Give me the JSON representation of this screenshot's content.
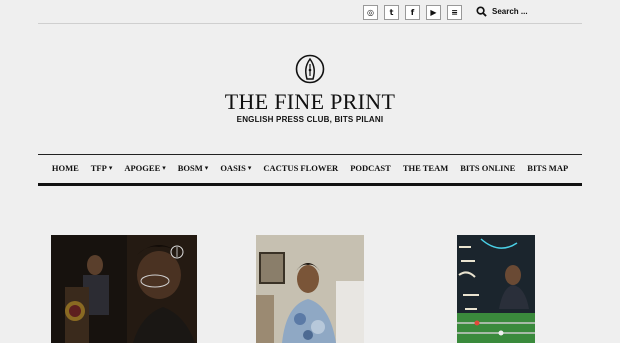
{
  "header": {
    "social": [
      {
        "icon": "instagram-icon",
        "glyph": "◎"
      },
      {
        "icon": "twitter-icon",
        "glyph": "t"
      },
      {
        "icon": "facebook-icon",
        "glyph": "f"
      },
      {
        "icon": "youtube-icon",
        "glyph": "▶"
      },
      {
        "icon": "spotify-icon",
        "glyph": "≡"
      }
    ],
    "search_placeholder": "Search ..."
  },
  "brand": {
    "title": "THE FINE PRINT",
    "subtitle": "ENGLISH PRESS CLUB, BITS PILANI"
  },
  "nav": {
    "items": [
      {
        "label": "HOME",
        "dropdown": false
      },
      {
        "label": "TFP",
        "dropdown": true
      },
      {
        "label": "APOGEE",
        "dropdown": true
      },
      {
        "label": "BOSM",
        "dropdown": true
      },
      {
        "label": "OASIS",
        "dropdown": true
      },
      {
        "label": "CACTUS FLOWER",
        "dropdown": false
      },
      {
        "label": "PODCAST",
        "dropdown": false
      },
      {
        "label": "THE TEAM",
        "dropdown": false
      },
      {
        "label": "BITS ONLINE",
        "dropdown": false
      },
      {
        "label": "BITS MAP",
        "dropdown": false
      }
    ],
    "chevron": "▾"
  },
  "colors": {
    "background": "#efefef",
    "text": "#111111"
  }
}
